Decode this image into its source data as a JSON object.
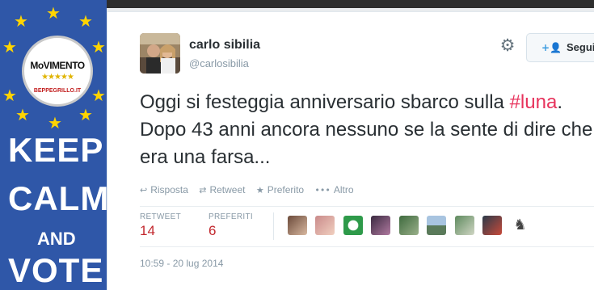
{
  "poster": {
    "logo_main": "MoVIMENTO",
    "logo_stars": "★★★★★",
    "logo_url": "BEPPEGRILLO.IT",
    "line1": "KEEP",
    "line2": "CALM",
    "line3": "AND",
    "line4": "VOTE"
  },
  "tweet": {
    "author_name": "carlo sibilia",
    "author_handle": "@carlosibilia",
    "follow_label": "Segui",
    "text_part1": "Oggi si festeggia anniversario sbarco sulla ",
    "hashtag": "#luna",
    "text_part2": ". Dopo 43 anni ancora nessuno se la sente di dire che era una farsa...",
    "actions": {
      "reply": "Risposta",
      "retweet": "Retweet",
      "favorite": "Preferito",
      "more": "Altro"
    },
    "stats": {
      "retweet_label": "RETWEET",
      "retweet_count": "14",
      "favorites_label": "PREFERITI",
      "favorites_count": "6"
    },
    "timestamp": "10:59 - 20 lug 2014"
  },
  "icons": {
    "gear": "gear-icon",
    "follow": "add-user-icon",
    "reply": "reply-icon",
    "retweet": "retweet-icon",
    "favorite": "star-icon",
    "more": "more-icon"
  },
  "colors": {
    "hashtag": "#e7335c",
    "stat_value": "#c2272d",
    "muted": "#8899a6",
    "poster_blue": "#2f57a8",
    "poster_star": "#ffd400"
  }
}
